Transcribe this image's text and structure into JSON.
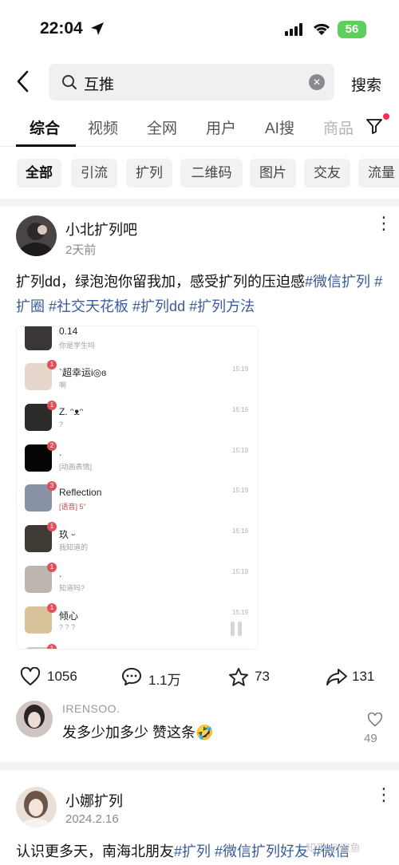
{
  "status_bar": {
    "time": "22:04",
    "battery": "56"
  },
  "search": {
    "query": "互推",
    "button": "搜索"
  },
  "tabs": [
    {
      "label": "综合",
      "active": true
    },
    {
      "label": "视频",
      "active": false
    },
    {
      "label": "全网",
      "active": false
    },
    {
      "label": "用户",
      "active": false
    },
    {
      "label": "AI搜",
      "active": false
    },
    {
      "label": "商品",
      "active": false
    }
  ],
  "chips": [
    {
      "label": "全部",
      "active": true
    },
    {
      "label": "引流"
    },
    {
      "label": "扩列"
    },
    {
      "label": "二维码"
    },
    {
      "label": "图片"
    },
    {
      "label": "交友"
    },
    {
      "label": "流量"
    }
  ],
  "post1": {
    "author": "小北扩列吧",
    "time": "2天前",
    "text_plain": "扩列dd，绿泡泡你留我加，感受扩列的压迫感",
    "tag1": "#微信扩列",
    "tag2": "#扩圈",
    "tag3": "#社交天花板",
    "tag4": "#扩列dd",
    "tag5": "#扩列方法",
    "likes": "1056",
    "comments": "1.1万",
    "favorites": "73",
    "shares": "131",
    "screenshot": {
      "top_name": "0.14",
      "top_msg": "你是学生吗",
      "rows": [
        {
          "name": "`超幸运i◎ɞ",
          "msg": "啊",
          "time": "15:19",
          "badge": "1"
        },
        {
          "name": "Z.  ᵔᴥᵔ",
          "msg": "?",
          "time": "15:19",
          "badge": "1"
        },
        {
          "name": ".",
          "msg": "[动画表情]",
          "time": "15:19",
          "badge": "2"
        },
        {
          "name": "Reflection",
          "msg": "[语音] 5\"",
          "time": "15:19",
          "badge": "3"
        },
        {
          "name": "玖  ᵕ",
          "msg": "我知道的",
          "time": "15:19",
          "badge": "1"
        },
        {
          "name": ".",
          "msg": "知道吗?",
          "time": "15:19",
          "badge": "1"
        },
        {
          "name": "倾心",
          "msg": "? ? ?",
          "time": "15:19",
          "badge": "1"
        }
      ]
    }
  },
  "comment": {
    "user": "IRENSOO.",
    "text": "发多少加多少 赞这条🤣",
    "likes": "49"
  },
  "post2": {
    "author": "小娜扩列",
    "date": "2024.2.16",
    "text_plain": "认识更多天，南海北朋友",
    "tag1": "#扩列",
    "tag2": "#微信扩列好友",
    "tag3": "#微信"
  },
  "watermark": "知乎 @鲨鱼"
}
